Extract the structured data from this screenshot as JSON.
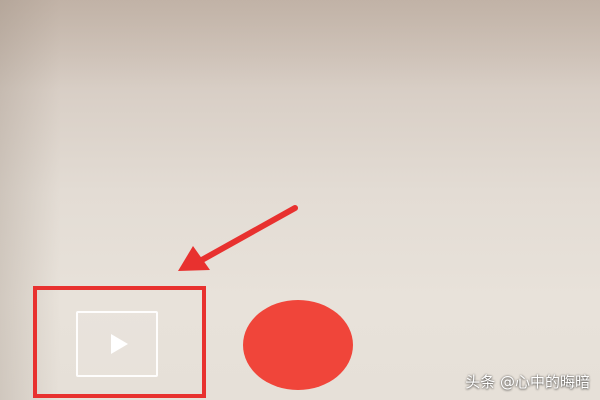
{
  "camera": {
    "gallery_button": {
      "icon": "play-icon"
    },
    "record_button": {
      "color": "#f0453a"
    }
  },
  "annotation": {
    "highlight_color": "#e8312f",
    "arrow_color": "#e8312f"
  },
  "watermark": {
    "text": "头条 @心中的晦暗"
  }
}
